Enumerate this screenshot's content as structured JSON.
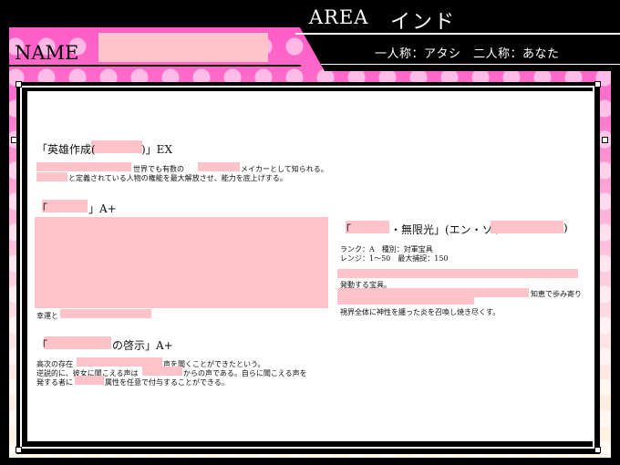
{
  "header": {
    "area_label": "AREA",
    "area_value": "インド",
    "name_label": "NAME",
    "pronouns": "一人称：アタシ　二人称：あなた"
  },
  "skills": {
    "skill1": {
      "prefix": "「英雄作成(",
      "suffix": ")」EX",
      "line1": "世界でも有数の",
      "line1b": "メイカーとして知られる。",
      "line2": "と定義されている人物の権能を最大解放させ、能力を底上げする。"
    },
    "skill2": {
      "prefix": "「",
      "suffix": "」A+",
      "footer": "幸運と"
    },
    "skill3": {
      "prefix": "「",
      "suffix": "の啓示」A+",
      "line1a": "高次の存在",
      "line1b": "声を聞くことができたという。",
      "line2a": "逆説的に、彼女に聞こえる声は",
      "line2b": "からの声である。自らに聞こえる声を",
      "line3a": "発する者に",
      "line3b": "属性を任意で付与することができる。"
    },
    "np": {
      "prefix": "「",
      "mid": "・無限光」(エン・ソフ",
      "suffix": ")",
      "stats1": "ランク：A　種別：対軍宝具",
      "stats2": "レンジ：1〜50　最大捕捉：150",
      "line1": "発動する宝具。",
      "line2": "知恵で歩み寄り",
      "line3": "視界全体に神性を纏った炎を召喚し焼き尽くす。"
    }
  }
}
